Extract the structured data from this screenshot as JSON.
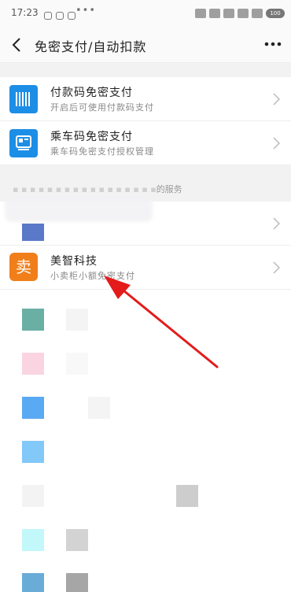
{
  "status_bar": {
    "time": "17:23",
    "dots": "•••",
    "battery": "100"
  },
  "nav": {
    "title": "免密支付/自动扣款"
  },
  "top_items": [
    {
      "title": "付款码免密支付",
      "subtitle": "开启后可使用付款码支付",
      "icon": "barcode-icon"
    },
    {
      "title": "乘车码免密支付",
      "subtitle": "乘车码免密支付授权管理",
      "icon": "transit-card-icon"
    }
  ],
  "group_label_partial": "的服务",
  "highlighted_item": {
    "title": "美智科技",
    "subtitle": "小卖柜小额免密支付",
    "icon_glyph": "卖"
  },
  "colors": {
    "accent_blue": "#1d8ee6",
    "meizhi_orange": "#f07f1a",
    "arrow_red": "#e31b1b"
  }
}
